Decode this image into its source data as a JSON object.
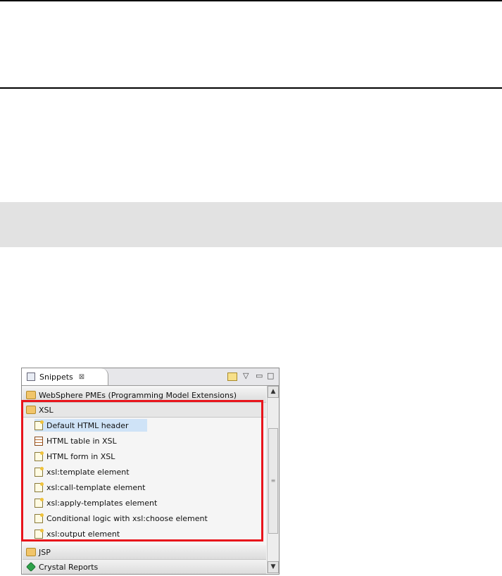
{
  "snippets_view": {
    "tab_label": "Snippets",
    "tab_close": "⊠",
    "toolbar": {
      "customize_icon": "customize-icon",
      "menu": "▽",
      "minimize": "▭",
      "maximize": "□"
    },
    "drawers": [
      {
        "label": "WebSphere PMEs (Programming Model Extensions)",
        "open": false
      },
      {
        "label": "XSL",
        "open": true
      },
      {
        "label": "JSP",
        "open": false
      },
      {
        "label": "Crystal Reports",
        "open": false
      }
    ],
    "xsl_items": [
      {
        "label": "Default HTML header",
        "selected": true
      },
      {
        "label": "HTML table in XSL"
      },
      {
        "label": "HTML form in XSL"
      },
      {
        "label": "xsl:template element"
      },
      {
        "label": "xsl:call-template element"
      },
      {
        "label": "xsl:apply-templates element"
      },
      {
        "label": "Conditional logic with xsl:choose element"
      },
      {
        "label": "xsl:output element"
      }
    ],
    "scroll_up": "▲",
    "scroll_down": "▼",
    "scroll_grip": "≡"
  },
  "colors": {
    "highlight": "#e8141b",
    "selection": "#cfe3f7"
  }
}
